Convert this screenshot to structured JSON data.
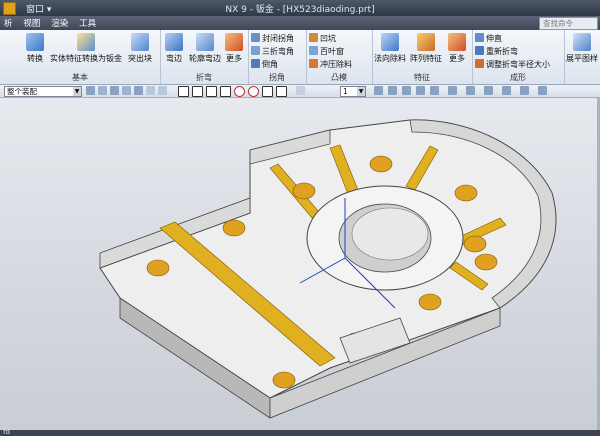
{
  "titlebar": {
    "window_menu": "窗口 ▾",
    "title": "NX 9 - 钣金 - [HX523diaoding.prt]"
  },
  "menubar": {
    "items": [
      "析",
      "视图",
      "渲染",
      "工具"
    ]
  },
  "search": {
    "placeholder": "查找命令"
  },
  "ribbon": {
    "groups": [
      {
        "label": "基本",
        "buttons": [
          "转换",
          "实体特征转换为钣金",
          "突出块"
        ]
      },
      {
        "label": "折弯",
        "buttons": [
          "弯边",
          "轮廓弯边",
          "更多"
        ]
      },
      {
        "label": "拐角",
        "buttons": [
          "封闭拐角",
          "三折弯角",
          "倒角"
        ]
      },
      {
        "label": "凸模",
        "buttons": [
          "凹坑",
          "百叶窗",
          "冲压除料"
        ]
      },
      {
        "label": "特征",
        "buttons": [
          "法向除料",
          "阵列特征",
          "更多"
        ]
      },
      {
        "label": "成形",
        "buttons": [
          "伸直",
          "重新折弯",
          "调整折弯半径大小"
        ]
      },
      {
        "label": "",
        "buttons": [
          "展平图样"
        ]
      }
    ]
  },
  "toolbar": {
    "filter_value": "整个装配",
    "layer_value": "1"
  },
  "statusbar": {
    "text": "fd"
  },
  "colors": {
    "accent": "#e0a020",
    "ribbon_top": "#f4f7fb",
    "titlebar": "#2f3846",
    "part_gold": "#e0b020"
  },
  "icons": [
    "convert-icon",
    "solid-to-sheetmetal-icon",
    "tab-icon",
    "flange-icon",
    "contour-flange-icon",
    "more-icon"
  ]
}
